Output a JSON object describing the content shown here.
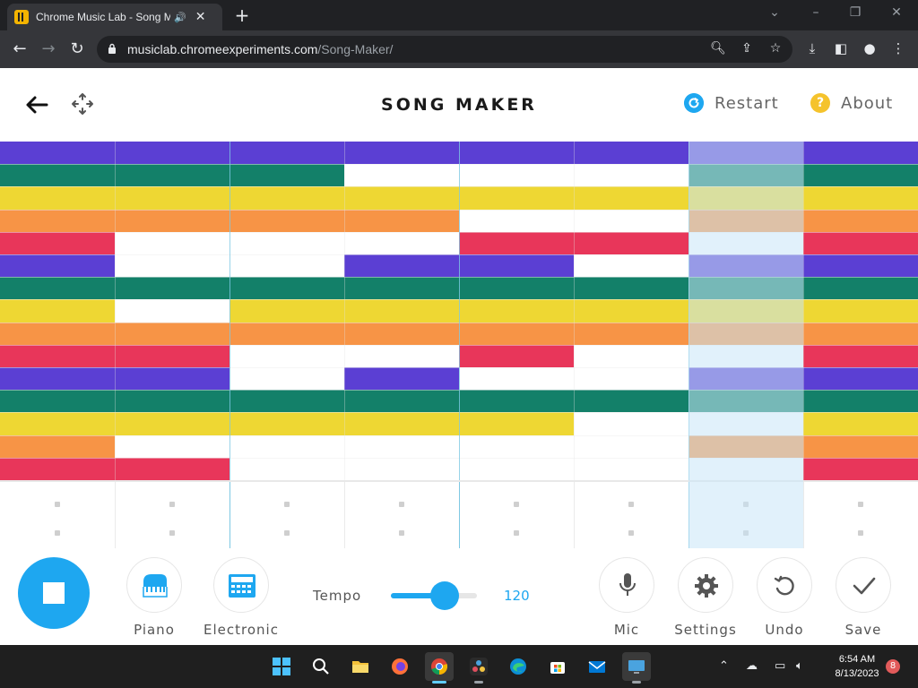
{
  "browser": {
    "tab_title": "Chrome Music Lab - Song M",
    "url_host": "musiclab.chromeexperiments.com",
    "url_path": "/Song-Maker/"
  },
  "header": {
    "title": "SONG MAKER",
    "restart_label": "Restart",
    "about_label": "About",
    "about_glyph": "?"
  },
  "grid": {
    "columns": 8,
    "rows": 15,
    "row_colors": [
      "#5b3fd3",
      "#138069",
      "#eed733",
      "#f79446",
      "#e8365a",
      "#5b3fd3",
      "#138069",
      "#eed733",
      "#f79446",
      "#e8365a",
      "#5b3fd3",
      "#138069",
      "#eed733",
      "#f79446",
      "#e8365a"
    ],
    "filled": [
      [
        0,
        1,
        2,
        3,
        4,
        5,
        6,
        7
      ],
      [
        0,
        1,
        2,
        6,
        7
      ],
      [
        0,
        1,
        2,
        3,
        4,
        5,
        6,
        7
      ],
      [
        0,
        1,
        2,
        3,
        6,
        7
      ],
      [
        0,
        4,
        5,
        7
      ],
      [
        0,
        3,
        4,
        6,
        7
      ],
      [
        0,
        1,
        2,
        3,
        4,
        5,
        6,
        7
      ],
      [
        0,
        2,
        3,
        4,
        5,
        6,
        7
      ],
      [
        0,
        1,
        2,
        3,
        4,
        5,
        6,
        7
      ],
      [
        0,
        1,
        4,
        7
      ],
      [
        0,
        1,
        3,
        6,
        7
      ],
      [
        0,
        1,
        2,
        3,
        4,
        5,
        6,
        7
      ],
      [
        0,
        1,
        2,
        3,
        4,
        7
      ],
      [
        0,
        6,
        7
      ],
      [
        0,
        1,
        7
      ]
    ],
    "playhead_column": 6
  },
  "controls": {
    "instrument_label": "Piano",
    "percussion_label": "Electronic",
    "tempo_label": "Tempo",
    "tempo_value": "120",
    "tempo_fraction": 0.62,
    "mic_label": "Mic",
    "settings_label": "Settings",
    "undo_label": "Undo",
    "save_label": "Save"
  },
  "taskbar": {
    "time": "6:54 AM",
    "date": "8/13/2023",
    "notification_count": "8"
  },
  "colors": {
    "accent": "#1ea7f0",
    "about_yellow": "#f5c32c"
  }
}
